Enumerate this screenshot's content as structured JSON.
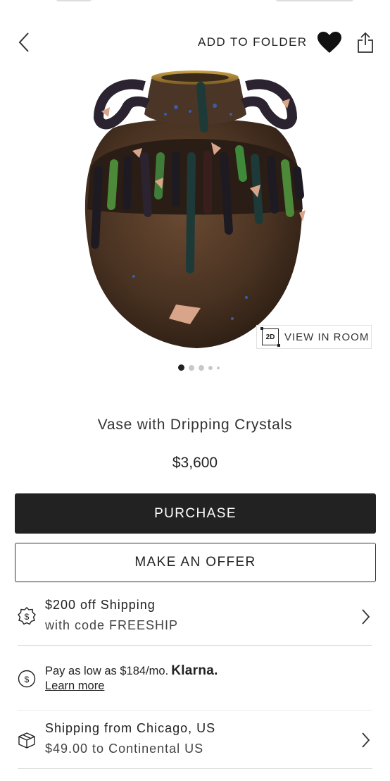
{
  "header": {
    "add_to_folder_label": "ADD TO FOLDER"
  },
  "gallery": {
    "view_in_room_badge": "2D",
    "view_in_room_label": "VIEW IN ROOM",
    "dot_count": 5,
    "active_dot": 1
  },
  "product": {
    "title": "Vase with Dripping Crystals",
    "price": "$3,600"
  },
  "actions": {
    "purchase_label": "PURCHASE",
    "offer_label": "MAKE AN OFFER"
  },
  "shipping_promo": {
    "icon": "dollar-badge-icon",
    "line1": "$200 off Shipping",
    "line2": "with code FREESHIP"
  },
  "klarna": {
    "icon": "dollar-circle-icon",
    "text": "Pay as low as $184/mo.",
    "brand": "Klarna.",
    "link": "Learn more"
  },
  "shipping_info": {
    "icon": "box-icon",
    "line1": "Shipping from Chicago, US",
    "line2": "$49.00 to Continental US"
  },
  "colors": {
    "primary_button": "#222222",
    "divider": "#d9d9d9"
  }
}
